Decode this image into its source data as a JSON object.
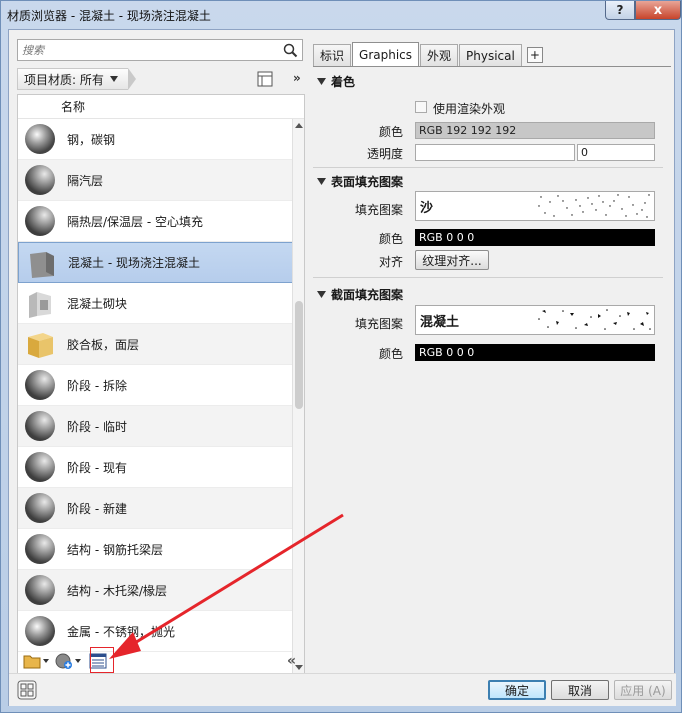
{
  "window": {
    "title": "材质浏览器 - 混凝土 - 现场浇注混凝土",
    "help_label": "?",
    "close_label": "x"
  },
  "left": {
    "search_placeholder": "搜索",
    "filter_label": "项目材质: 所有",
    "more_label": "»",
    "list_header": "名称",
    "items": [
      {
        "label": "钢，碳钢",
        "thumb": "metal-sphere"
      },
      {
        "label": "隔汽层",
        "thumb": "gray-sphere"
      },
      {
        "label": "隔热层/保温层 - 空心填充",
        "thumb": "gray-sphere"
      },
      {
        "label": "混凝土 - 现场浇注混凝土",
        "thumb": "concrete-cube",
        "selected": true
      },
      {
        "label": "混凝土砌块",
        "thumb": "block"
      },
      {
        "label": "胶合板，面层",
        "thumb": "wood-cube"
      },
      {
        "label": "阶段 - 拆除",
        "thumb": "gray-sphere"
      },
      {
        "label": "阶段 - 临时",
        "thumb": "gray-sphere"
      },
      {
        "label": "阶段 - 现有",
        "thumb": "gray-sphere"
      },
      {
        "label": "阶段 - 新建",
        "thumb": "gray-sphere"
      },
      {
        "label": "结构 - 钢筋托梁层",
        "thumb": "gray-sphere"
      },
      {
        "label": "结构 - 木托梁/椽层",
        "thumb": "gray-sphere"
      },
      {
        "label": "金属 - 不锈钢，抛光",
        "thumb": "metal-sphere"
      }
    ],
    "collapse_label": "«"
  },
  "tabs": [
    "标识",
    "Graphics",
    "外观",
    "Physical"
  ],
  "tab_add": "+",
  "graphics": {
    "shading": {
      "title": "着色",
      "use_render_label": "使用渲染外观",
      "color_label": "颜色",
      "color_value": "RGB 192 192 192",
      "transparency_label": "透明度",
      "transparency_value": "0"
    },
    "surface": {
      "title": "表面填充图案",
      "pattern_label": "填充图案",
      "pattern_value": "沙",
      "color_label": "颜色",
      "color_value": "RGB 0 0 0",
      "align_label": "对齐",
      "align_button": "纹理对齐..."
    },
    "cut": {
      "title": "截面填充图案",
      "pattern_label": "填充图案",
      "pattern_value": "混凝土",
      "color_label": "颜色",
      "color_value": "RGB 0 0 0"
    }
  },
  "buttons": {
    "ok": "确定",
    "cancel": "取消",
    "apply": "应用 (A)"
  },
  "colors": {
    "selection": "#b6cdec",
    "annotation": "#e5252b"
  }
}
